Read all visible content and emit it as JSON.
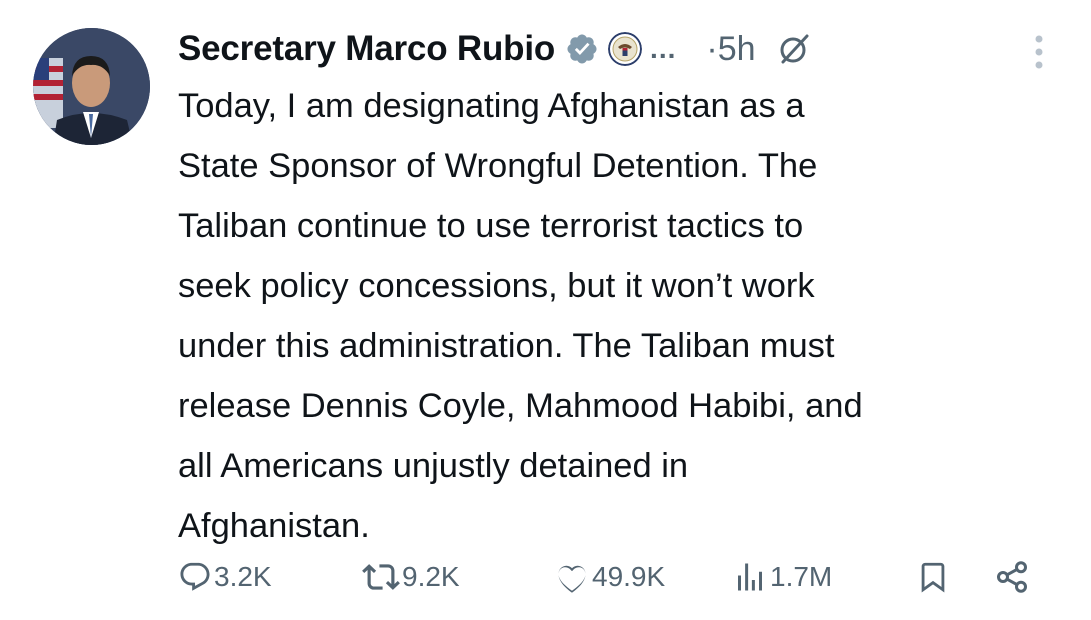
{
  "author": {
    "display_name": "Secretary Marco Rubio",
    "verified_icon": "verified-badge-icon",
    "affiliation_icon": "state-department-seal-icon",
    "overflow_text": "...",
    "timestamp": "·5h",
    "grok_icon": "grok-icon",
    "more_icon": "more-vertical-icon"
  },
  "tweet": {
    "text": "Today, I am designating Afghanistan as a\nState Sponsor of Wrongful Detention. The\nTaliban continue to use terrorist tactics to\nseek policy concessions, but it won’t work\nunder this administration. The Taliban must\nrelease Dennis Coyle, Mahmood Habibi, and\nall Americans unjustly detained in\nAfghanistan."
  },
  "actions": {
    "replies": "3.2K",
    "reposts": "9.2K",
    "likes": "49.9K",
    "views": "1.7M"
  },
  "colors": {
    "text": "#0f1419",
    "muted": "#536471",
    "verified": "#829aab"
  }
}
